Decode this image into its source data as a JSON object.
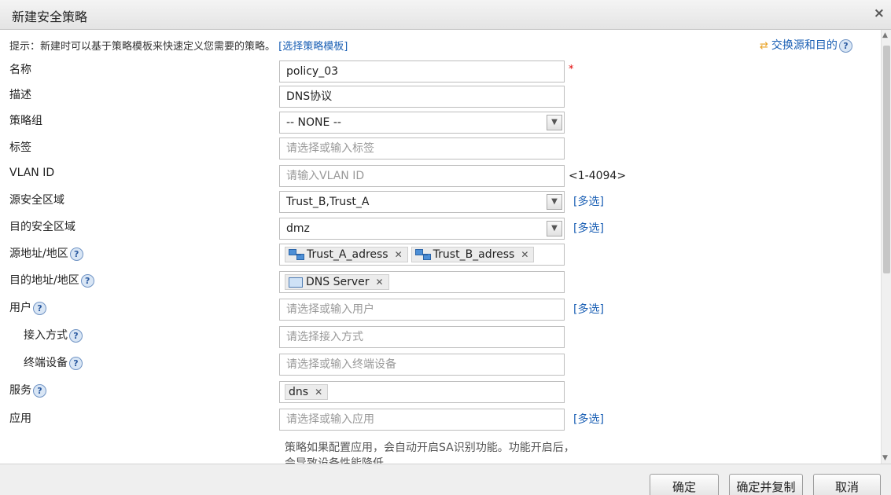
{
  "dialog": {
    "title": "新建安全策略",
    "close": "×"
  },
  "hint": {
    "text": "提示：新建时可以基于策略模板来快速定义您需要的策略。",
    "link": "[选择策略模板]"
  },
  "swap": {
    "icon": "swap-arrows-icon",
    "label": "交换源和目的"
  },
  "help_glyph": "?",
  "required_mark": "*",
  "fields": {
    "name": {
      "label": "名称",
      "value": "policy_03"
    },
    "desc": {
      "label": "描述",
      "value": "DNS协议"
    },
    "group": {
      "label": "策略组",
      "value": "-- NONE --"
    },
    "tag": {
      "label": "标签",
      "placeholder": "请选择或输入标签"
    },
    "vlan": {
      "label": "VLAN ID",
      "placeholder": "请输入VLAN ID",
      "range": "<1-4094>"
    },
    "src_zone": {
      "label": "源安全区域",
      "value": "Trust_B,Trust_A",
      "multi": "[多选]"
    },
    "dst_zone": {
      "label": "目的安全区域",
      "value": "dmz",
      "multi": "[多选]"
    },
    "src_addr": {
      "label": "源地址/地区",
      "tags": [
        "Trust_A_adress",
        "Trust_B_adress"
      ]
    },
    "dst_addr": {
      "label": "目的地址/地区",
      "tags": [
        "DNS Server"
      ]
    },
    "user": {
      "label": "用户",
      "placeholder": "请选择或输入用户",
      "multi": "[多选]"
    },
    "access": {
      "label": "接入方式",
      "placeholder": "请选择接入方式"
    },
    "terminal": {
      "label": "终端设备",
      "placeholder": "请选择或输入终端设备"
    },
    "service": {
      "label": "服务",
      "tags": [
        "dns"
      ]
    },
    "app": {
      "label": "应用",
      "placeholder": "请选择或输入应用",
      "multi": "[多选]"
    }
  },
  "note": "策略如果配置应用，会自动开启SA识别功能。功能开启后，会导致设备性能降低。",
  "tag_remove": "✕",
  "buttons": {
    "ok": "确定",
    "ok_copy": "确定并复制",
    "cancel": "取消"
  }
}
